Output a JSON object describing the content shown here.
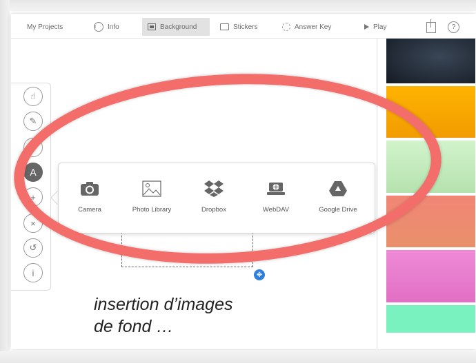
{
  "toolbar": {
    "my_projects": "My Projects",
    "info": "Info",
    "background": "Background",
    "stickers": "Stickers",
    "answer_key": "Answer Key",
    "play": "Play",
    "help": "?"
  },
  "side_tools": [
    {
      "name": "hand-icon",
      "glyph": "☝"
    },
    {
      "name": "pencil-icon",
      "glyph": "✎"
    },
    {
      "name": "eraser-icon",
      "glyph": "◇"
    },
    {
      "name": "text-icon",
      "glyph": "A",
      "active": true
    },
    {
      "name": "plus-icon",
      "glyph": "+"
    },
    {
      "name": "close-icon",
      "glyph": "×"
    },
    {
      "name": "undo-icon",
      "glyph": "↺"
    },
    {
      "name": "info-icon",
      "glyph": "i"
    }
  ],
  "sources": [
    {
      "name": "camera",
      "label": "Camera",
      "icon": "camera-icon"
    },
    {
      "name": "photo-library",
      "label": "Photo Library",
      "icon": "photo-library-icon"
    },
    {
      "name": "dropbox",
      "label": "Dropbox",
      "icon": "dropbox-icon"
    },
    {
      "name": "webdav",
      "label": "WebDAV",
      "icon": "webdav-icon"
    },
    {
      "name": "google-drive",
      "label": "Google Drive",
      "icon": "google-drive-icon"
    }
  ],
  "caption": {
    "line1": "insertion d’images",
    "line2": "de fond …"
  },
  "colors": {
    "highlight": "#f36d6a",
    "swatches": [
      "#1f2a36",
      "#f5a800",
      "#c7ecc0",
      "#ee8a76",
      "#e982d0",
      "#79f2c0"
    ],
    "move_handle": "#2f7ee0"
  }
}
